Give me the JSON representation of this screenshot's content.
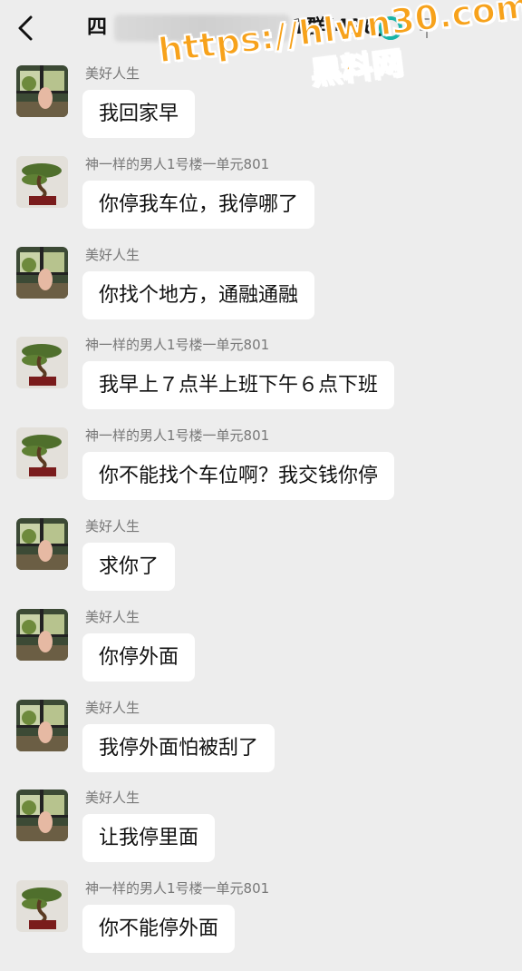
{
  "header": {
    "title_start": "四",
    "title_end": "1群",
    "member_count": "(496)",
    "accent_color": "#16b3a7"
  },
  "watermark": {
    "url": "https://hlwn30.com",
    "label": "黑料网",
    "color": "#f7a21b"
  },
  "messages": [
    {
      "sender": "美好人生",
      "text": "我回家早",
      "avatar": "window-plant"
    },
    {
      "sender": "神一样的男人1号楼一单元801",
      "text": "你停我车位，我停哪了",
      "avatar": "bonsai"
    },
    {
      "sender": "美好人生",
      "text": "你找个地方，通融通融",
      "avatar": "window-plant"
    },
    {
      "sender": "神一样的男人1号楼一单元801",
      "text": "我早上７点半上班下午６点下班",
      "avatar": "bonsai"
    },
    {
      "sender": "神一样的男人1号楼一单元801",
      "text": "你不能找个车位啊？我交钱你停",
      "avatar": "bonsai"
    },
    {
      "sender": "美好人生",
      "text": "求你了",
      "avatar": "window-plant"
    },
    {
      "sender": "美好人生",
      "text": "你停外面",
      "avatar": "window-plant"
    },
    {
      "sender": "美好人生",
      "text": "我停外面怕被刮了",
      "avatar": "window-plant"
    },
    {
      "sender": "美好人生",
      "text": "让我停里面",
      "avatar": "window-plant"
    },
    {
      "sender": "神一样的男人1号楼一单元801",
      "text": "你不能停外面",
      "avatar": "bonsai"
    }
  ]
}
